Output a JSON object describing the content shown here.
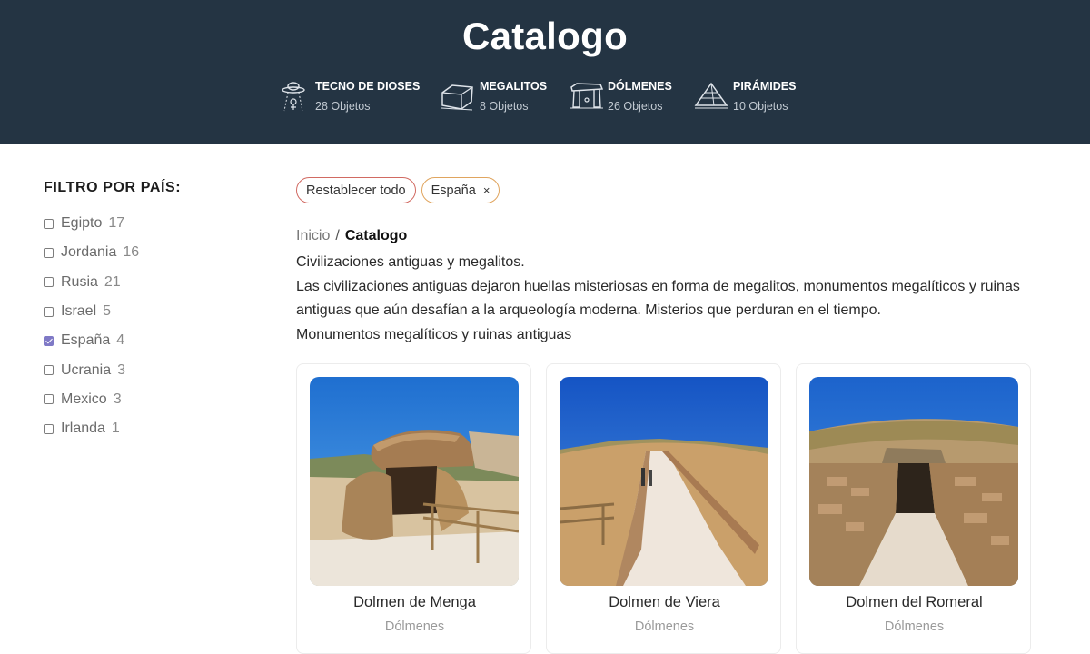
{
  "header": {
    "title": "Catalogo",
    "categories": [
      {
        "name": "TECNO DE DIOSES",
        "count": "28 Objetos",
        "icon": "ufo-icon"
      },
      {
        "name": "MEGALITOS",
        "count": "8 Objetos",
        "icon": "megalith-icon"
      },
      {
        "name": "DÓLMENES",
        "count": "26 Objetos",
        "icon": "dolmen-icon"
      },
      {
        "name": "PIRÁMIDES",
        "count": "10 Objetos",
        "icon": "pyramid-icon"
      }
    ]
  },
  "sidebar": {
    "title": "FILTRO POR PAÍS:",
    "filters": [
      {
        "label": "Egipto",
        "count": "17",
        "checked": false
      },
      {
        "label": "Jordania",
        "count": "16",
        "checked": false
      },
      {
        "label": "Rusia",
        "count": "21",
        "checked": false
      },
      {
        "label": "Israel",
        "count": "5",
        "checked": false
      },
      {
        "label": "España",
        "count": "4",
        "checked": true
      },
      {
        "label": "Ucrania",
        "count": "3",
        "checked": false
      },
      {
        "label": "Mexico",
        "count": "3",
        "checked": false
      },
      {
        "label": "Irlanda",
        "count": "1",
        "checked": false
      }
    ]
  },
  "chips": {
    "reset_label": "Restablecer todo",
    "active_filter": "España",
    "remove_symbol": "×"
  },
  "breadcrumb": {
    "home": "Inicio",
    "separator": "/",
    "current": "Catalogo"
  },
  "description": {
    "line1": "Civilizaciones antiguas y megalitos.",
    "line2": "Las civilizaciones antiguas dejaron huellas misteriosas en forma de megalitos, monumentos megalíticos y ruinas antiguas que aún desafían a la arqueología moderna. Misterios que perduran en el tiempo.",
    "line3": "Monumentos megalíticos y ruinas antiguas"
  },
  "cards": [
    {
      "title": "Dolmen de Menga",
      "category": "Dólmenes"
    },
    {
      "title": "Dolmen de Viera",
      "category": "Dólmenes"
    },
    {
      "title": "Dolmen del Romeral",
      "category": "Dólmenes"
    }
  ],
  "colors": {
    "header_bg": "#243443",
    "checkbox_accent": "#7f79c6",
    "chip_reset_border": "#d16a62",
    "chip_filter_border": "#e0a55f"
  }
}
